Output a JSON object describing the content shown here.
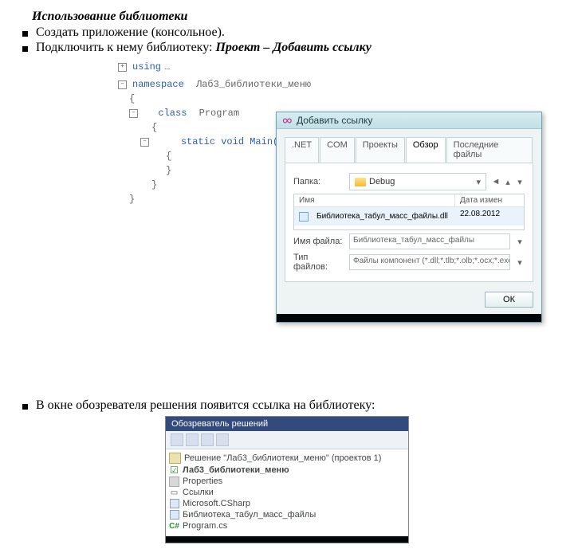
{
  "heading": "Использование библиотеки",
  "bullets": {
    "create_app": "Создать приложение (консольное).",
    "connect_prefix": "Подключить к нему библиотеку: ",
    "connect_em": "Проект – Добавить ссылку",
    "explorer_note": "В окне обозревателя решения появится ссылка на библиотеку:"
  },
  "code": {
    "using": "using",
    "namespace_kw": "namespace",
    "namespace_name": "Лаб3_библиотеки_меню",
    "class_kw": "class",
    "class_name": "Program",
    "method": "static void Main(",
    "brace_open": "{",
    "brace_close": "}"
  },
  "dialog": {
    "title": "Добавить ссылку",
    "tabs": {
      "net": ".NET",
      "com": "COM",
      "projects": "Проекты",
      "browse": "Обзор",
      "recent": "Последние файлы"
    },
    "labels": {
      "folder": "Папка:",
      "name": "Имя",
      "date": "Дата измен",
      "filename": "Имя файла:",
      "filetype": "Тип файлов:"
    },
    "folder_value": "Debug",
    "file_name": "Библиотека_табул_масс_файлы.dll",
    "file_date": "22.08.2012",
    "filename_value": "Библиотека_табул_масс_файлы",
    "filetype_value": "Файлы компонент (*.dll;*.tlb;*.olb;*.ocx;*.exe;*.manife",
    "ok": "ОК"
  },
  "solution": {
    "panel_title": "Обозреватель решений",
    "root": "Решение \"Лаб3_библиотеки_меню\" (проектов 1)",
    "project": "Лаб3_библиотеки_меню",
    "properties": "Properties",
    "refs": "Ссылки",
    "ref1": "Microsoft.CSharp",
    "ref2": "Библиотека_табул_масс_файлы",
    "program": "Program.cs"
  }
}
